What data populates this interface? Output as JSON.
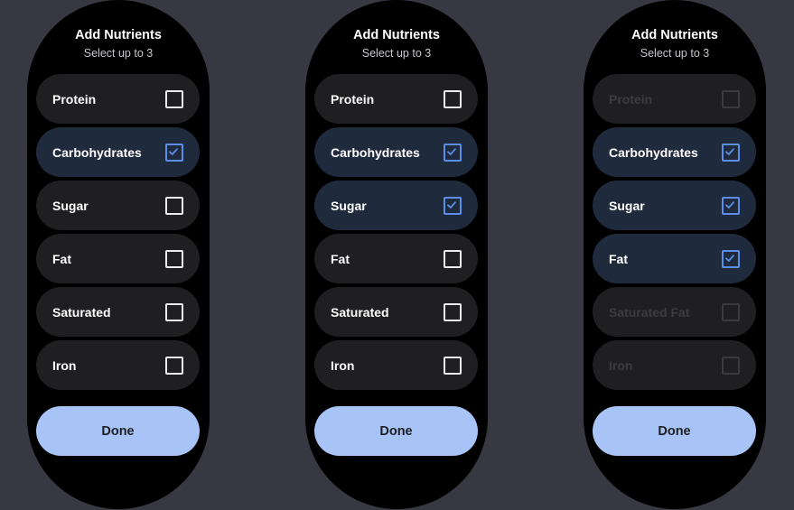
{
  "colors": {
    "background": "#383842",
    "device": "#000000",
    "row": "#1f1f21",
    "row_selected": "#1f2a3c",
    "checkbox_checked": "#5b8eea",
    "done_button": "#a8c4f6"
  },
  "screens": [
    {
      "title": "Add Nutrients",
      "subtitle": "Select up to 3",
      "items": [
        {
          "label": "Protein",
          "checked": false,
          "disabled": false
        },
        {
          "label": "Carbohydrates",
          "checked": true,
          "disabled": false
        },
        {
          "label": "Sugar",
          "checked": false,
          "disabled": false
        },
        {
          "label": "Fat",
          "checked": false,
          "disabled": false
        },
        {
          "label": "Saturated",
          "checked": false,
          "disabled": false
        },
        {
          "label": "Iron",
          "checked": false,
          "disabled": false
        }
      ],
      "done_label": "Done"
    },
    {
      "title": "Add Nutrients",
      "subtitle": "Select up to 3",
      "items": [
        {
          "label": "Protein",
          "checked": false,
          "disabled": false
        },
        {
          "label": "Carbohydrates",
          "checked": true,
          "disabled": false
        },
        {
          "label": "Sugar",
          "checked": true,
          "disabled": false
        },
        {
          "label": "Fat",
          "checked": false,
          "disabled": false
        },
        {
          "label": "Saturated",
          "checked": false,
          "disabled": false
        },
        {
          "label": "Iron",
          "checked": false,
          "disabled": false
        }
      ],
      "done_label": "Done"
    },
    {
      "title": "Add Nutrients",
      "subtitle": "Select up to 3",
      "items": [
        {
          "label": "Protein",
          "checked": false,
          "disabled": true
        },
        {
          "label": "Carbohydrates",
          "checked": true,
          "disabled": false
        },
        {
          "label": "Sugar",
          "checked": true,
          "disabled": false
        },
        {
          "label": "Fat",
          "checked": true,
          "disabled": false
        },
        {
          "label": "Saturated Fat",
          "checked": false,
          "disabled": true
        },
        {
          "label": "Iron",
          "checked": false,
          "disabled": true
        }
      ],
      "done_label": "Done"
    }
  ]
}
